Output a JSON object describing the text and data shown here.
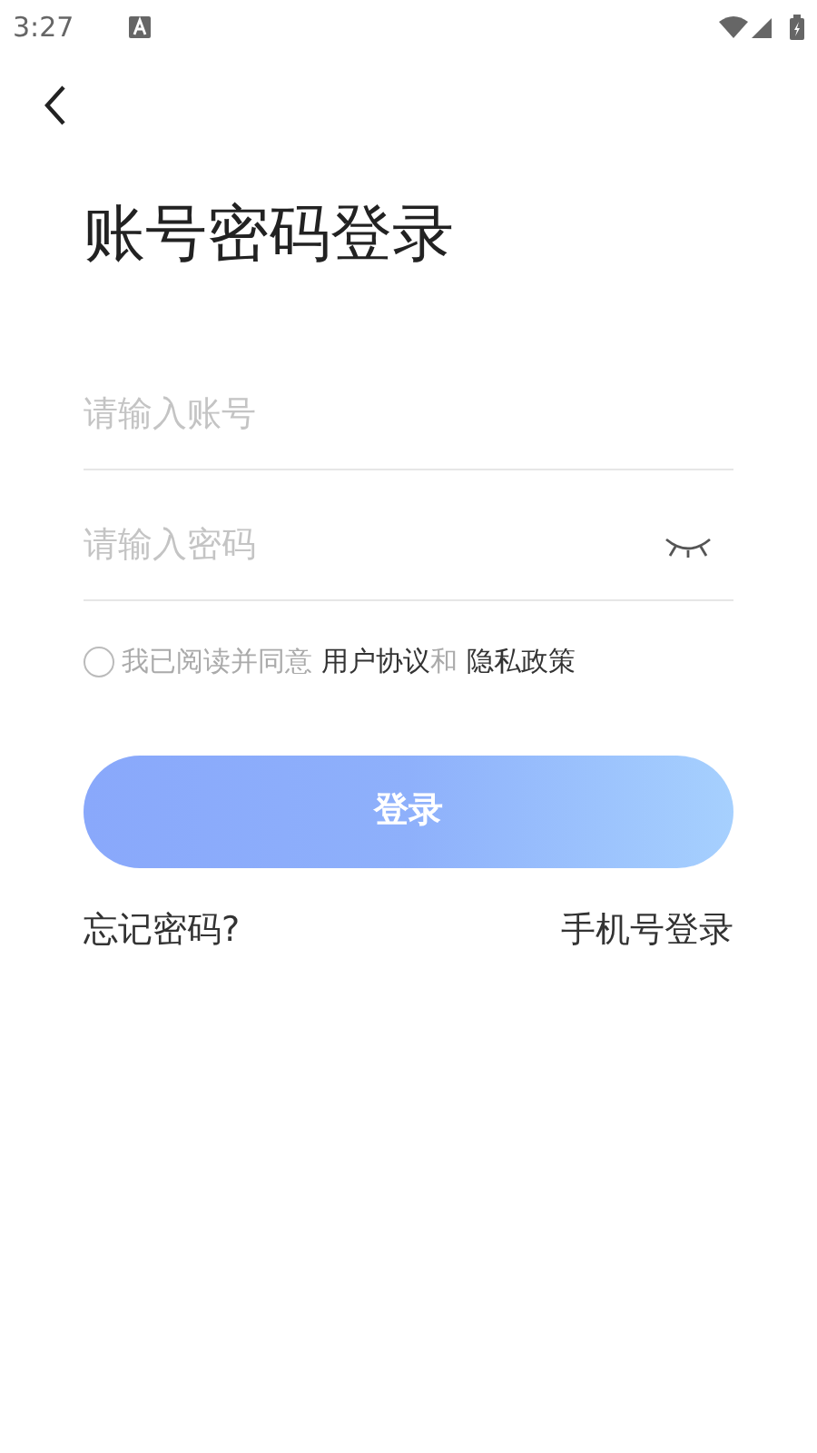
{
  "status_bar": {
    "time": "3:27"
  },
  "title": "账号密码登录",
  "account_field": {
    "placeholder": "请输入账号"
  },
  "password_field": {
    "placeholder": "请输入密码",
    "password_visible": false
  },
  "agreement": {
    "checked": false,
    "prefix": "我已阅读并同意",
    "user_agreement": "用户协议",
    "conjunction": "和",
    "privacy_policy": "隐私政策"
  },
  "login_button": {
    "label": "登录"
  },
  "forgot_password": "忘记密码?",
  "phone_login": "手机号登录"
}
